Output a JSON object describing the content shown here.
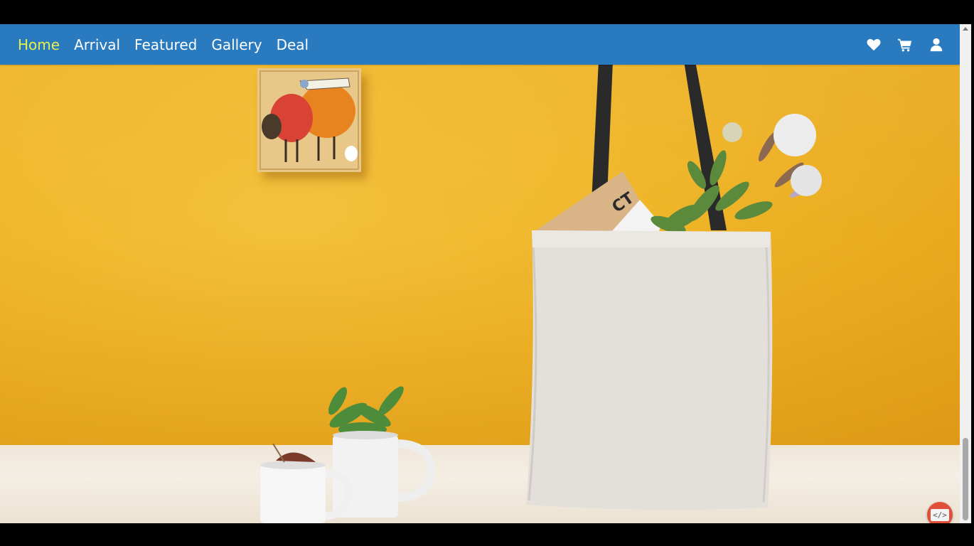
{
  "nav": {
    "links": [
      {
        "label": "Home",
        "active": true
      },
      {
        "label": "Arrival",
        "active": false
      },
      {
        "label": "Featured",
        "active": false
      },
      {
        "label": "Gallery",
        "active": false
      },
      {
        "label": "Deal",
        "active": false
      }
    ],
    "icons": [
      "heart-icon",
      "cart-icon",
      "user-icon"
    ],
    "active_color": "#e6f04a",
    "bar_color": "#2a7abf"
  },
  "hero": {
    "wall_color": "#efb427",
    "table_color": "#f1e9dc",
    "bag_tag_text": "CT"
  },
  "badge": {
    "label": "</>"
  }
}
